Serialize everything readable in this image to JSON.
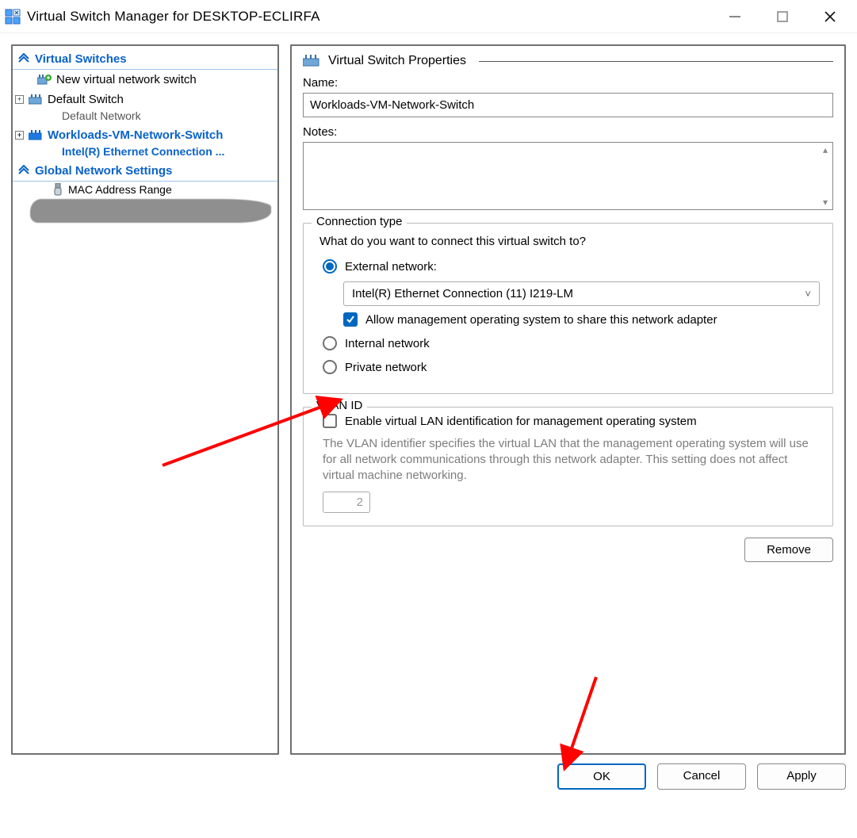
{
  "window": {
    "title": "Virtual Switch Manager for DESKTOP-ECLIRFA"
  },
  "sidebar": {
    "sections": [
      {
        "title": "Virtual Switches",
        "items": [
          {
            "label": "New virtual network switch",
            "sub": null
          },
          {
            "label": "Default Switch",
            "sub": "Default Network"
          },
          {
            "label": "Workloads-VM-Network-Switch",
            "sub": "Intel(R) Ethernet Connection ..."
          }
        ]
      },
      {
        "title": "Global Network Settings",
        "items": [
          {
            "label": "MAC Address Range",
            "sub": null
          }
        ]
      }
    ]
  },
  "detail": {
    "header": "Virtual Switch Properties",
    "name_label": "Name:",
    "name_value": "Workloads-VM-Network-Switch",
    "notes_label": "Notes:",
    "conn_group": {
      "legend": "Connection type",
      "question": "What do you want to connect this virtual switch to?",
      "external_label": "External network:",
      "adapter_selected": "Intel(R) Ethernet Connection (11) I219-LM",
      "allow_mgmt_label": "Allow management operating system to share this network adapter",
      "internal_label": "Internal network",
      "private_label": "Private network"
    },
    "vlan_group": {
      "legend": "VLAN ID",
      "enable_label": "Enable virtual LAN identification for management operating system",
      "help": "The VLAN identifier specifies the virtual LAN that the management operating system will use for all network communications through this network adapter. This setting does not affect virtual machine networking.",
      "vlan_value": "2"
    },
    "remove_label": "Remove"
  },
  "buttons": {
    "ok": "OK",
    "cancel": "Cancel",
    "apply": "Apply"
  }
}
